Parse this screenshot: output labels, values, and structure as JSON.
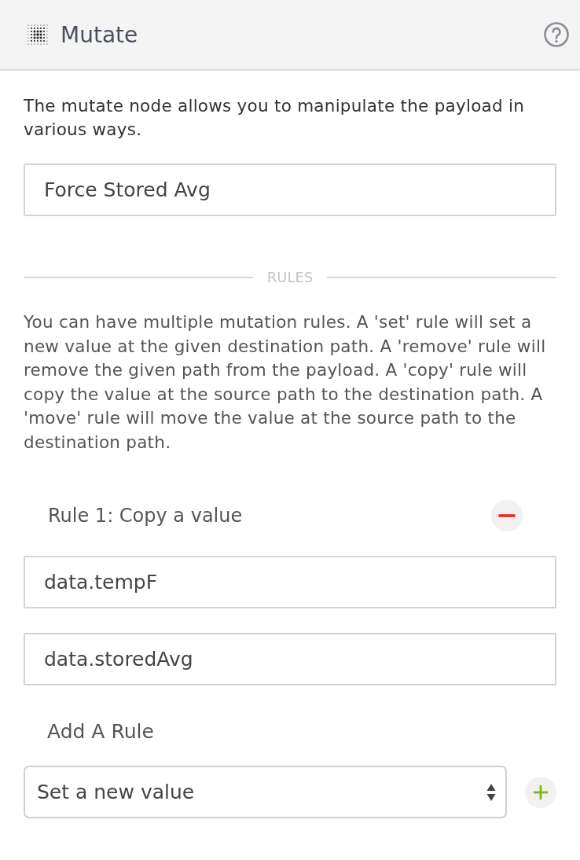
{
  "header": {
    "title": "Mutate"
  },
  "description": "The mutate node allows you to manipulate the payload in various ways.",
  "name_field": {
    "value": "Force Stored Avg"
  },
  "section_divider": {
    "label": "RULES"
  },
  "rules_help": "You can have multiple mutation rules. A 'set' rule will set a new value at the given destination path. A 'remove' rule will remove the given path from the payload. A 'copy' rule will copy the value at the source path to the destination path. A 'move' rule will move the value at the source path to the destination path.",
  "rules": [
    {
      "title": "Rule 1: Copy a value",
      "fields": [
        {
          "value": "data.tempF"
        },
        {
          "value": "data.storedAvg"
        }
      ]
    }
  ],
  "add_rule": {
    "label": "Add A Rule",
    "select": {
      "value": "Set a new value"
    }
  }
}
